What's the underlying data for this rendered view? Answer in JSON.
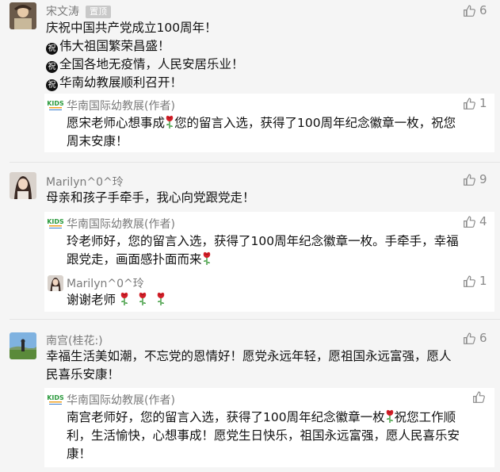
{
  "comments": [
    {
      "author": "宋文涛",
      "pin_label": "置顶",
      "likes": "6",
      "lines": [
        "庆祝中国共产党成立100周年！"
      ],
      "bullet_char": "祝",
      "bullets": [
        "伟大祖国繁荣昌盛！",
        "全国各地无疫情，人民安居乐业！",
        "华南幼教展顺利召开！"
      ],
      "reply": {
        "author": "华南国际幼教展(作者)",
        "likes": "1",
        "line1a": "愿宋老师心想事成",
        "line1b": "您的留言入选，获得了100周年纪念徽章一枚，祝您",
        "line2": "周末安康！"
      }
    },
    {
      "author": "Marilyn^0^玲",
      "likes": "9",
      "line1": "母亲和孩子手牵手，我心向党跟党走！",
      "reply": {
        "author": "华南国际幼教展(作者)",
        "likes": "4",
        "line1": "玲老师好，您的留言入选，获得了100周年纪念徽章一枚。手牵手，幸福",
        "line2": "跟党走，画面感扑面而来"
      },
      "reply2": {
        "author": "Marilyn^0^玲",
        "likes": "1",
        "line1": "谢谢老师"
      }
    },
    {
      "author": "南宫(桂花:)",
      "likes": "6",
      "line1": "幸福生活美如潮，不忘党的恩情好！愿党永远年轻，愿祖国永远富强，愿人",
      "line2": "民喜乐安康！",
      "reply": {
        "author": "华南国际幼教展(作者)",
        "line1a": "南宫老师好，您的留言入选，获得了100周年纪念徽章一枚",
        "line1b": "祝您工作顺",
        "line2": "利，生活愉快，心想事成！愿党生日快乐，祖国永远富强，愿人民喜乐安",
        "line3": "康！"
      }
    }
  ]
}
